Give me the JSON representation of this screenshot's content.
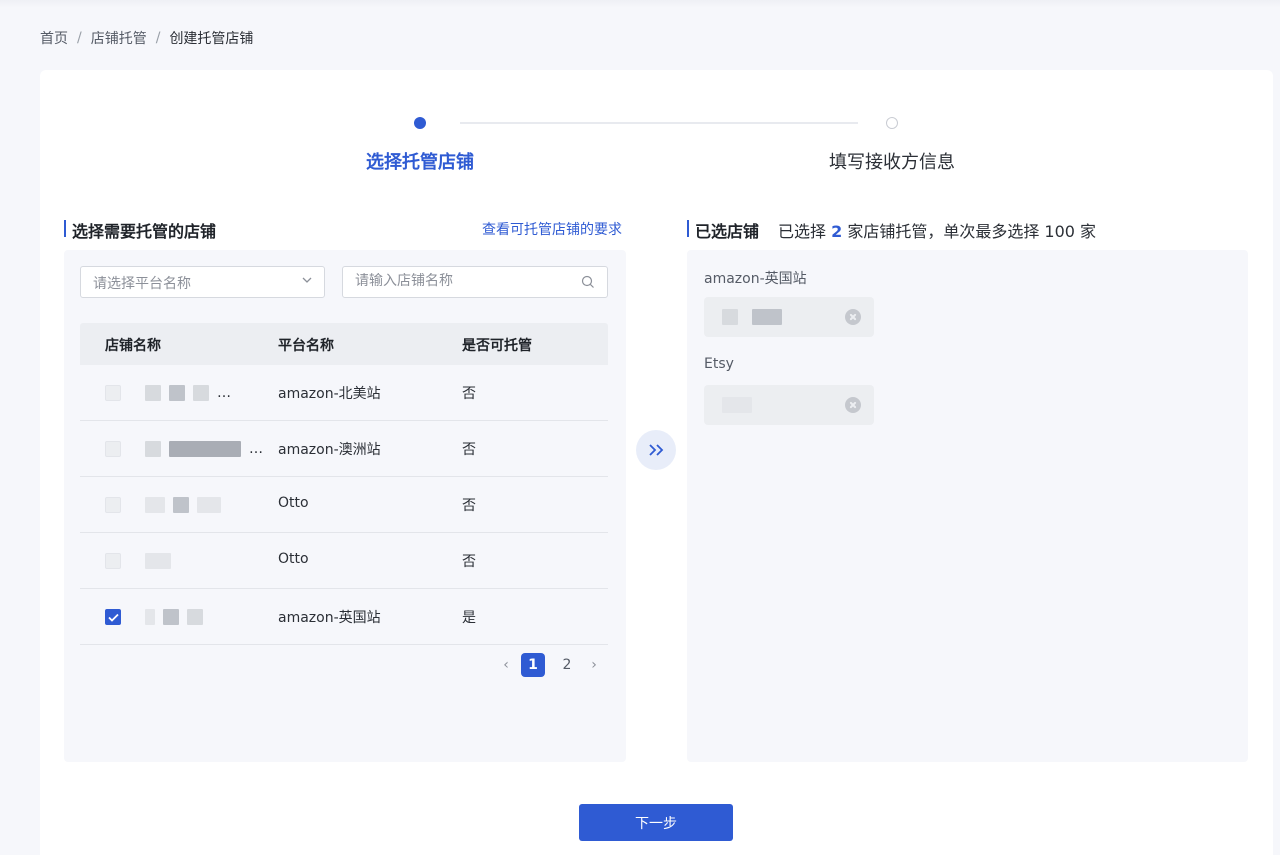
{
  "breadcrumb": {
    "items": [
      "首页",
      "店铺托管",
      "创建托管店铺"
    ],
    "separator": "/"
  },
  "steps": [
    {
      "label": "选择托管店铺",
      "state": "active"
    },
    {
      "label": "填写接收方信息",
      "state": "pending"
    }
  ],
  "left": {
    "title": "选择需要托管的店铺",
    "requirements_link": "查看可托管店铺的要求",
    "platform_select_placeholder": "请选择平台名称",
    "shop_search_placeholder": "请输入店铺名称",
    "columns": [
      "店铺名称",
      "平台名称",
      "是否可托管"
    ],
    "rows": [
      {
        "shop": "…",
        "platform": "amazon-北美站",
        "eligible": "否",
        "checked": false
      },
      {
        "shop": "…",
        "platform": "amazon-澳洲站",
        "eligible": "否",
        "checked": false
      },
      {
        "shop": "",
        "platform": "Otto",
        "eligible": "否",
        "checked": false
      },
      {
        "shop": "",
        "platform": "Otto",
        "eligible": "否",
        "checked": false
      },
      {
        "shop": "",
        "platform": "amazon-英国站",
        "eligible": "是",
        "checked": true
      }
    ],
    "pagination": {
      "pages": [
        "1",
        "2"
      ],
      "current": "1"
    }
  },
  "right": {
    "title": "已选店铺",
    "summary_prefix": "已选择",
    "selected_count": "2",
    "summary_suffix": "家店铺托管，单次最多选择 100 家",
    "groups": [
      {
        "platform": "amazon-英国站"
      },
      {
        "platform": "Etsy"
      }
    ]
  },
  "actions": {
    "next": "下一步"
  },
  "icons": {
    "transfer": "double-chevron-right-icon",
    "search": "search-icon",
    "dropdown": "chevron-down-icon"
  },
  "colors": {
    "primary": "#2f5bd3",
    "panel_bg": "#f6f7fb"
  }
}
